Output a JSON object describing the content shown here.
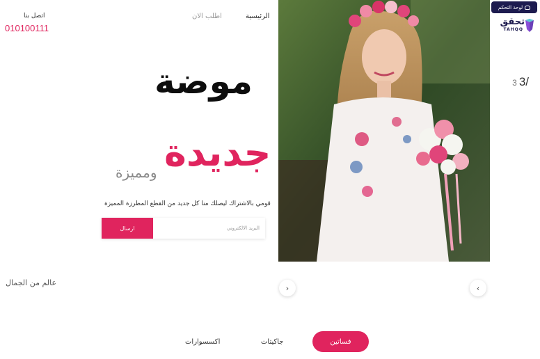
{
  "header": {
    "dashboard_label": "لوحة التحكم",
    "logo_ar": "تحقق",
    "logo_en": "TAHQQ",
    "nav": {
      "home": "الرئيسية",
      "order": "اطلب الان"
    },
    "contact": {
      "label": "اتصل بنا",
      "phone": "010100111"
    }
  },
  "hero": {
    "line1": "موضة",
    "line2": "جديدة",
    "line3": "ومميزة",
    "subtitle": "قومي بالاشتراك ليصلك منا كل جديد من القطع المطرزة المميزة"
  },
  "subscribe": {
    "placeholder": "البريد الالكتروني",
    "button": "ارسال"
  },
  "slider": {
    "current": "3/",
    "total": "3"
  },
  "section": {
    "title": "عالم من الجمال"
  },
  "tabs": [
    {
      "label": "فساتين",
      "active": true
    },
    {
      "label": "جاكيتات",
      "active": false
    },
    {
      "label": "اكسسوارات",
      "active": false
    }
  ],
  "colors": {
    "accent": "#e0245e",
    "brand": "#1d1b4f"
  }
}
